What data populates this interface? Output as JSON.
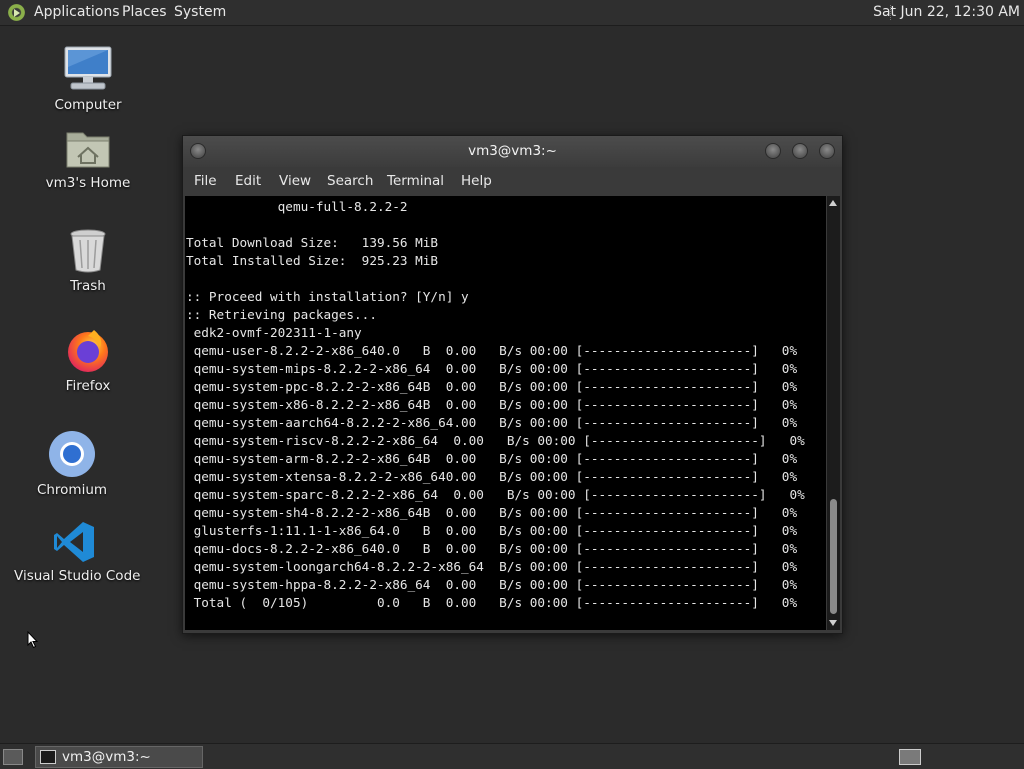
{
  "top_panel": {
    "menus": [
      "Applications",
      "Places",
      "System"
    ],
    "clock": "Sat Jun 22, 12:30 AM"
  },
  "desktop_icons": [
    {
      "label": "Computer",
      "icon": "computer-icon"
    },
    {
      "label": "vm3's Home",
      "icon": "home-folder-icon"
    },
    {
      "label": "Trash",
      "icon": "trash-icon"
    },
    {
      "label": "Firefox",
      "icon": "firefox-icon"
    },
    {
      "label": "Chromium",
      "icon": "chromium-icon"
    },
    {
      "label": "Visual Studio Code",
      "icon": "vscode-icon"
    }
  ],
  "terminal": {
    "title": "vm3@vm3:~",
    "menus": [
      "File",
      "Edit",
      "View",
      "Search",
      "Terminal",
      "Help"
    ],
    "lines": [
      "            qemu-full-8.2.2-2",
      "",
      "Total Download Size:   139.56 MiB",
      "Total Installed Size:  925.23 MiB",
      "",
      ":: Proceed with installation? [Y/n] y",
      ":: Retrieving packages...",
      " edk2-ovmf-202311-1-any",
      " qemu-user-8.2.2-2-x86_640.0   B  0.00   B/s 00:00 [----------------------]   0%",
      " qemu-system-mips-8.2.2-2-x86_64  0.00   B/s 00:00 [----------------------]   0%",
      " qemu-system-ppc-8.2.2-2-x86_64B  0.00   B/s 00:00 [----------------------]   0%",
      " qemu-system-x86-8.2.2-2-x86_64B  0.00   B/s 00:00 [----------------------]   0%",
      " qemu-system-aarch64-8.2.2-2-x86_64.00   B/s 00:00 [----------------------]   0%",
      " qemu-system-riscv-8.2.2-2-x86_64  0.00   B/s 00:00 [----------------------]   0%",
      " qemu-system-arm-8.2.2-2-x86_64B  0.00   B/s 00:00 [----------------------]   0%",
      " qemu-system-xtensa-8.2.2-2-x86_640.00   B/s 00:00 [----------------------]   0%",
      " qemu-system-sparc-8.2.2-2-x86_64  0.00   B/s 00:00 [----------------------]   0%",
      " qemu-system-sh4-8.2.2-2-x86_64B  0.00   B/s 00:00 [----------------------]   0%",
      " glusterfs-1:11.1-1-x86_64.0   B  0.00   B/s 00:00 [----------------------]   0%",
      " qemu-docs-8.2.2-2-x86_640.0   B  0.00   B/s 00:00 [----------------------]   0%",
      " qemu-system-loongarch64-8.2.2-2-x86_64  B/s 00:00 [----------------------]   0%",
      " qemu-system-hppa-8.2.2-2-x86_64  0.00   B/s 00:00 [----------------------]   0%",
      " Total (  0/105)         0.0   B  0.00   B/s 00:00 [----------------------]   0%"
    ]
  },
  "taskbar": {
    "window_button": "vm3@vm3:~"
  }
}
